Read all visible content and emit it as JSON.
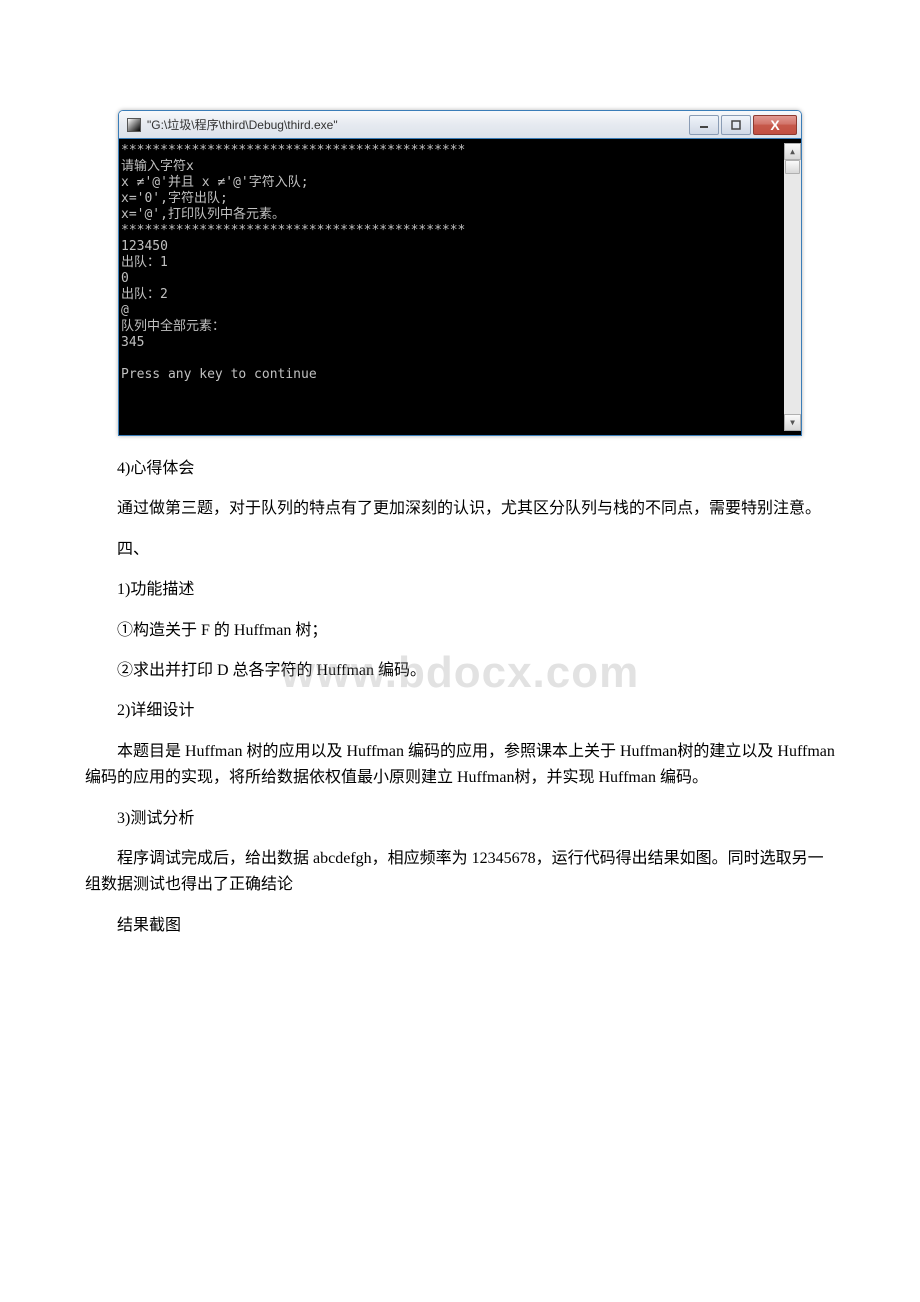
{
  "console": {
    "title": "\"G:\\垃圾\\程序\\third\\Debug\\third.exe\"",
    "minimize_label": "minimize",
    "maximize_label": "maximize",
    "close_label": "X",
    "output": "********************************************\n请输入字符x\nx ≠'@'并且 x ≠'@'字符入队;\nx='0',字符出队;\nx='@',打印队列中各元素。\n********************************************\n123450\n出队：1\n0\n出队：2\n@\n队列中全部元素：\n345\n\nPress any key to continue"
  },
  "doc": {
    "p1": "4)心得体会",
    "p2": "通过做第三题，对于队列的特点有了更加深刻的认识，尤其区分队列与栈的不同点，需要特别注意。",
    "p3": "四、",
    "p4": "1)功能描述",
    "p5": "①构造关于 F 的 Huffman 树；",
    "p6": "②求出并打印 D 总各字符的 Huffman 编码。",
    "p7": "2)详细设计",
    "p8": "本题目是 Huffman 树的应用以及 Huffman 编码的应用，参照课本上关于 Huffman树的建立以及 Huffman 编码的应用的实现，将所给数据依权值最小原则建立 Huffman树，并实现 Huffman 编码。",
    "p9": "3)测试分析",
    "p10": "程序调试完成后，给出数据 abcdefgh，相应频率为 12345678，运行代码得出结果如图。同时选取另一组数据测试也得出了正确结论",
    "p11": "结果截图"
  },
  "watermark": "www.bdocx.com"
}
